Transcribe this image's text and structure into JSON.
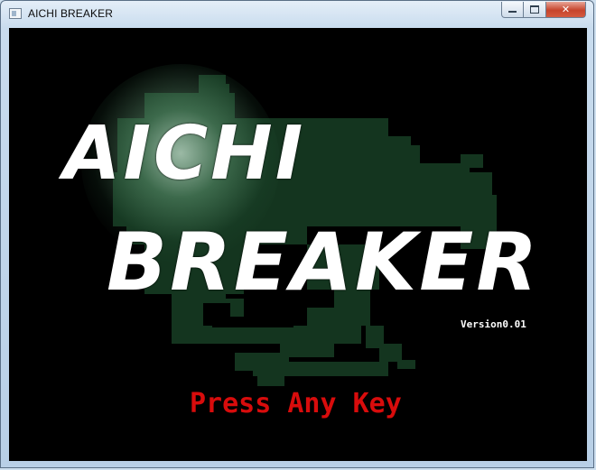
{
  "window": {
    "title": "AICHI BREAKER",
    "controls": {
      "minimize_icon": "minimize-icon",
      "maximize_icon": "maximize-icon",
      "close_glyph": "✕"
    }
  },
  "game": {
    "logo_line1": "AICHI",
    "logo_line2": "BREAKER",
    "version": "Version0.01",
    "prompt": "Press Any Key",
    "colors": {
      "background": "#000000",
      "map": "#14351f",
      "logo": "#ffffff",
      "prompt": "#d80c0c"
    }
  }
}
